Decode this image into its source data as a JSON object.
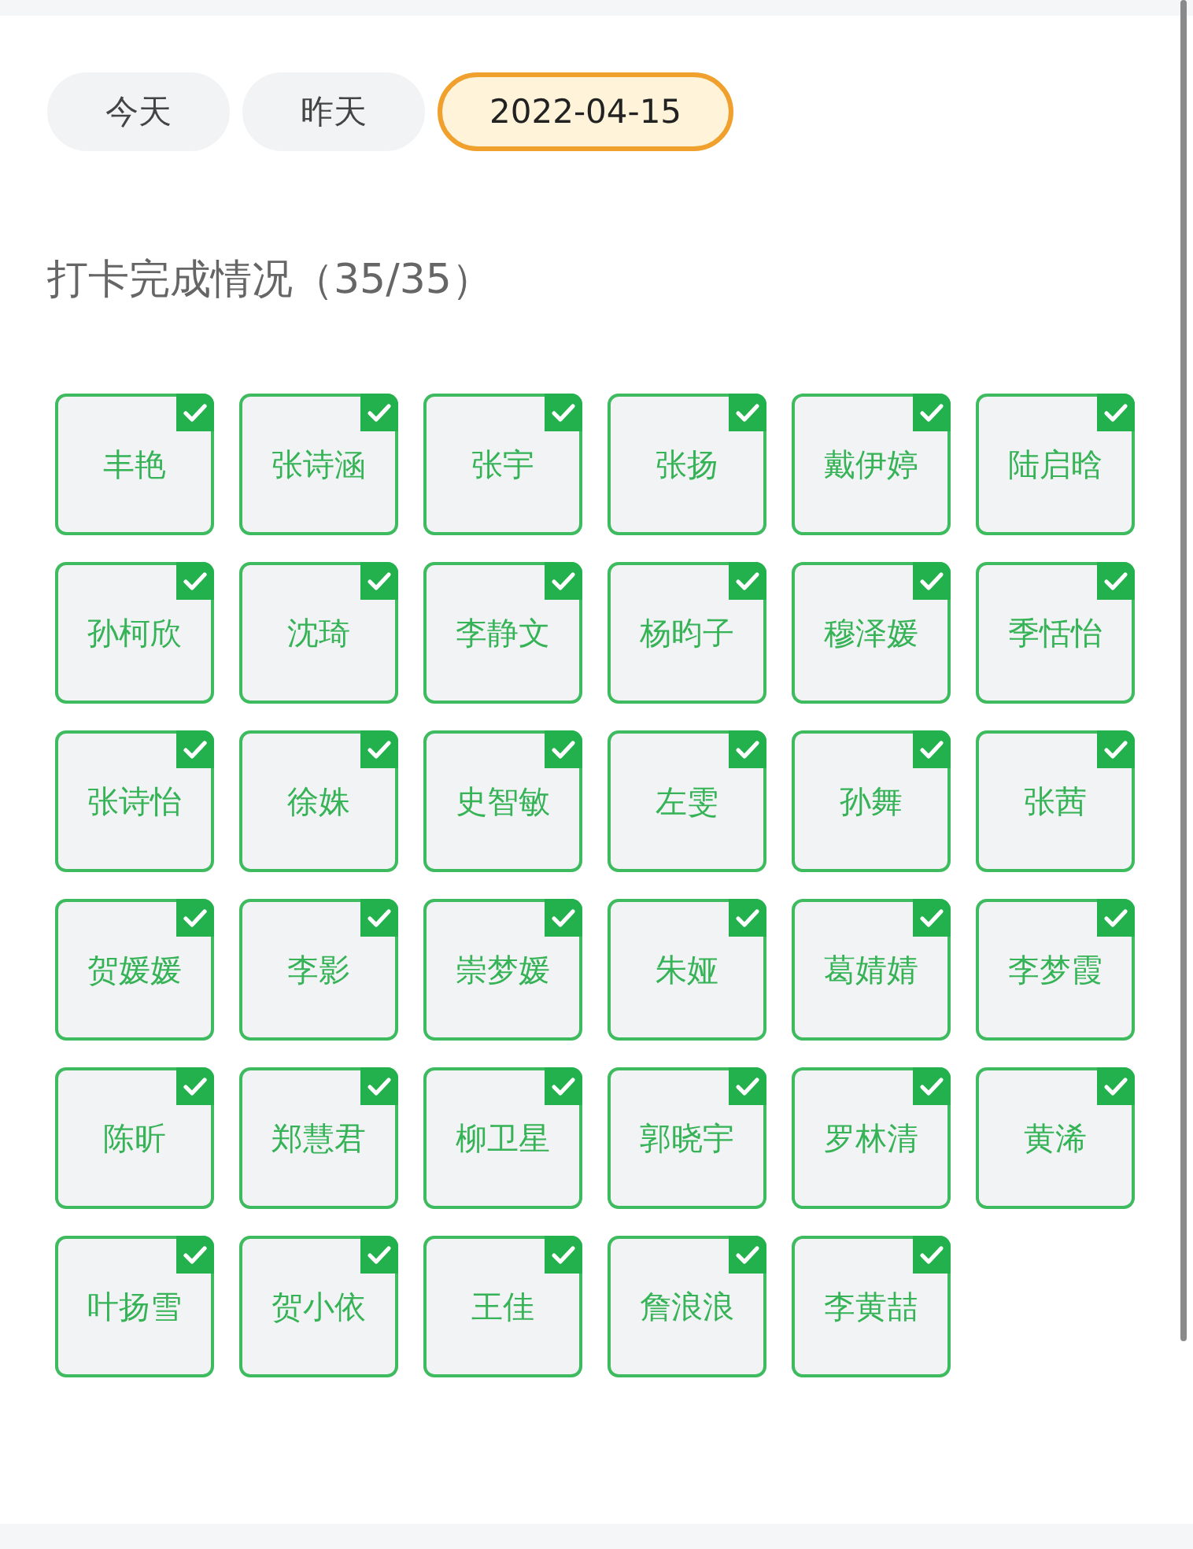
{
  "date_tabs": [
    {
      "label": "今天",
      "selected": false
    },
    {
      "label": "昨天",
      "selected": false
    },
    {
      "label": "2022-04-15",
      "selected": true
    }
  ],
  "section_title": "打卡完成情况（35/35）",
  "students": [
    {
      "name": "丰艳",
      "checked": true
    },
    {
      "name": "张诗涵",
      "checked": true
    },
    {
      "name": "张宇",
      "checked": true
    },
    {
      "name": "张扬",
      "checked": true
    },
    {
      "name": "戴伊婷",
      "checked": true
    },
    {
      "name": "陆启晗",
      "checked": true
    },
    {
      "name": "孙柯欣",
      "checked": true
    },
    {
      "name": "沈琦",
      "checked": true
    },
    {
      "name": "李静文",
      "checked": true
    },
    {
      "name": "杨昀子",
      "checked": true
    },
    {
      "name": "穆泽媛",
      "checked": true
    },
    {
      "name": "季恬怡",
      "checked": true
    },
    {
      "name": "张诗怡",
      "checked": true
    },
    {
      "name": "徐姝",
      "checked": true
    },
    {
      "name": "史智敏",
      "checked": true
    },
    {
      "name": "左雯",
      "checked": true
    },
    {
      "name": "孙舞",
      "checked": true
    },
    {
      "name": "张茜",
      "checked": true
    },
    {
      "name": "贺媛媛",
      "checked": true
    },
    {
      "name": "李影",
      "checked": true
    },
    {
      "name": "崇梦媛",
      "checked": true
    },
    {
      "name": "朱娅",
      "checked": true
    },
    {
      "name": "葛婧婧",
      "checked": true
    },
    {
      "name": "李梦霞",
      "checked": true
    },
    {
      "name": "陈昕",
      "checked": true
    },
    {
      "name": "郑慧君",
      "checked": true
    },
    {
      "name": "柳卫星",
      "checked": true
    },
    {
      "name": "郭晓宇",
      "checked": true
    },
    {
      "name": "罗林清",
      "checked": true
    },
    {
      "name": "黄浠",
      "checked": true
    },
    {
      "name": "叶扬雪",
      "checked": true
    },
    {
      "name": "贺小依",
      "checked": true
    },
    {
      "name": "王佳",
      "checked": true
    },
    {
      "name": "詹浪浪",
      "checked": true
    },
    {
      "name": "李黄喆",
      "checked": true
    }
  ]
}
